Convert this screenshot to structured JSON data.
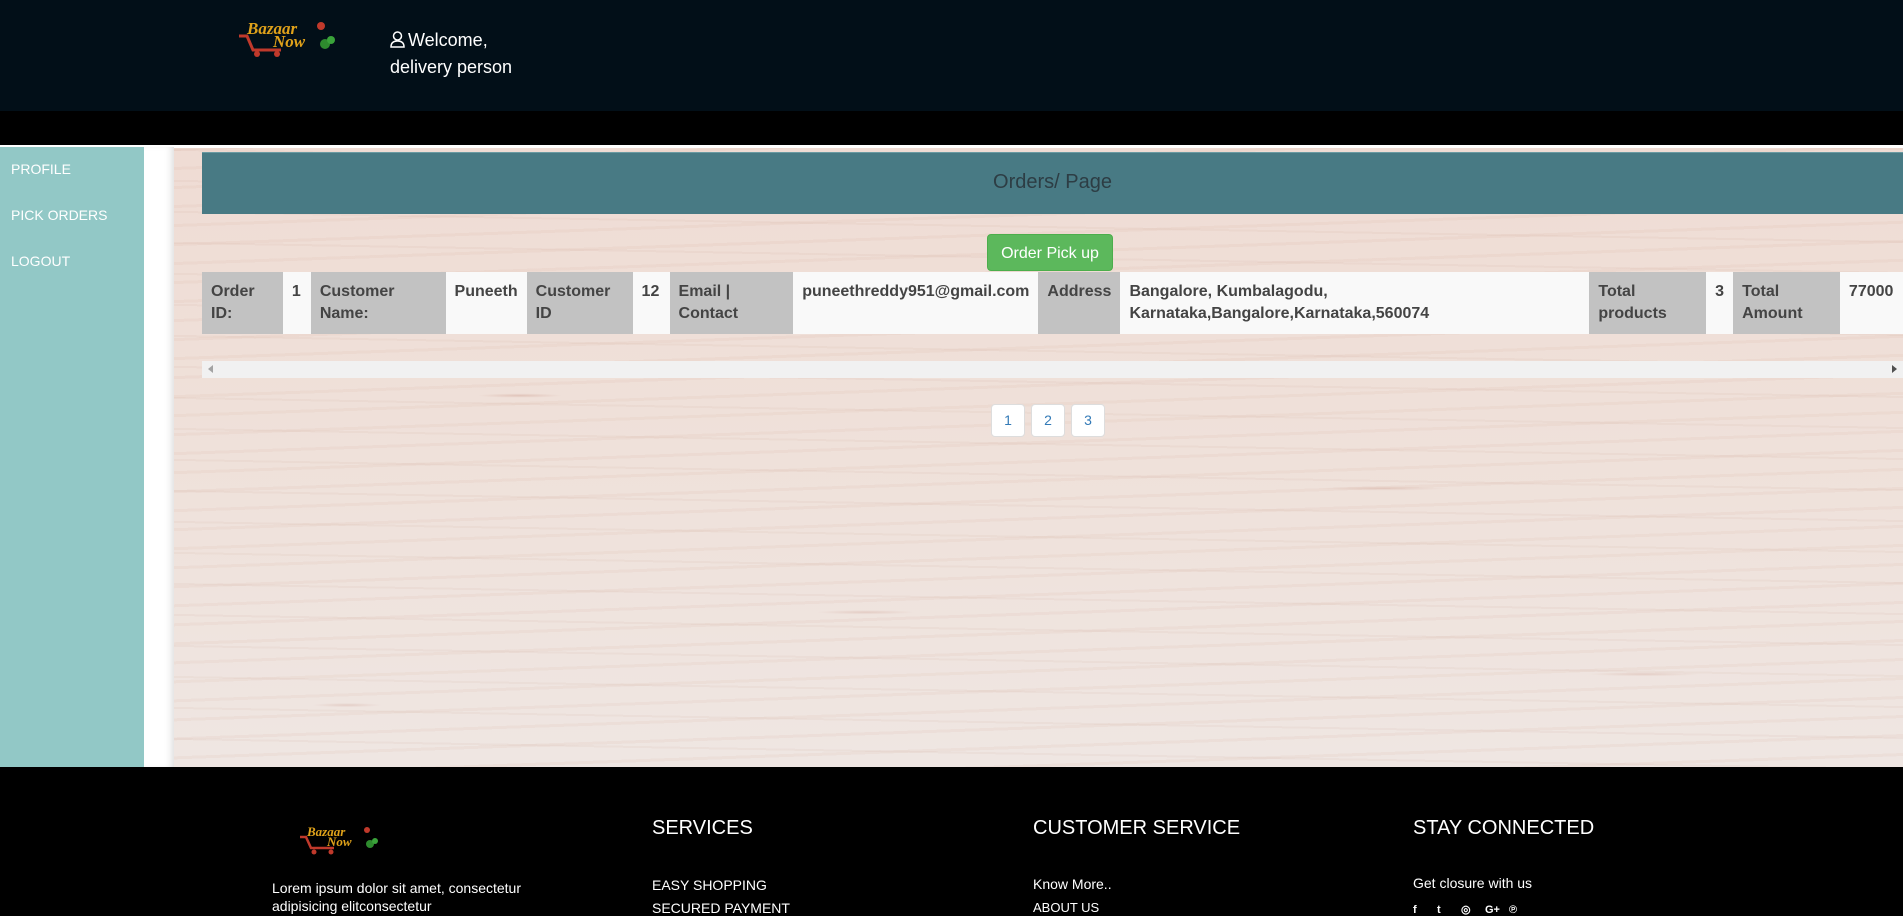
{
  "header": {
    "logo_text_top": "Bazaar",
    "logo_text_bottom": "Now",
    "welcome_line1": "Welcome,",
    "welcome_line2": "delivery person"
  },
  "sidebar": {
    "items": [
      {
        "label": "PROFILE"
      },
      {
        "label": "PICK ORDERS"
      },
      {
        "label": "LOGOUT"
      }
    ]
  },
  "main": {
    "heading": "Orders/ Page",
    "pickup_button": "Order Pick up",
    "order": {
      "order_id_label": "Order ID:",
      "order_id": "1",
      "customer_name_label": "Customer Name:",
      "customer_name": "Puneeth",
      "customer_id_label": "Customer ID",
      "customer_id": "12",
      "email_label": "Email | Contact",
      "email": "puneethreddy951@gmail.com",
      "address_label": "Address",
      "address": "Bangalore, Kumbalagodu, Karnataka,Bangalore,Karnataka,560074",
      "total_products_label": "Total products",
      "total_products": "3",
      "total_amount_label": "Total Amount",
      "total_amount": "77000"
    },
    "pages": [
      "1",
      "2",
      "3"
    ]
  },
  "footer": {
    "logo_text_top": "Bazaar",
    "logo_text_bottom": "Now",
    "lorem": "Lorem ipsum dolor sit amet, consectetur adipisicing elitconsectetur",
    "services": {
      "heading": "SERVICES",
      "items": [
        "EASY SHOPPING",
        "SECURED PAYMENT"
      ]
    },
    "customer_service": {
      "heading": "CUSTOMER SERVICE",
      "items": [
        "Know More..",
        "ABOUT US"
      ]
    },
    "stay_connected": {
      "heading": "STAY CONNECTED",
      "subtitle": "Get closure with us",
      "icons": [
        "facebook-icon",
        "twitter-icon",
        "instagram-icon",
        "google-plus-icon",
        "pinterest-icon"
      ]
    }
  },
  "colors": {
    "header_bg": "#020f18",
    "sidebar_bg": "#92c8c6",
    "panel_heading_bg": "#487a84",
    "button_green": "#5cb85c",
    "pager_link": "#337ab7"
  }
}
